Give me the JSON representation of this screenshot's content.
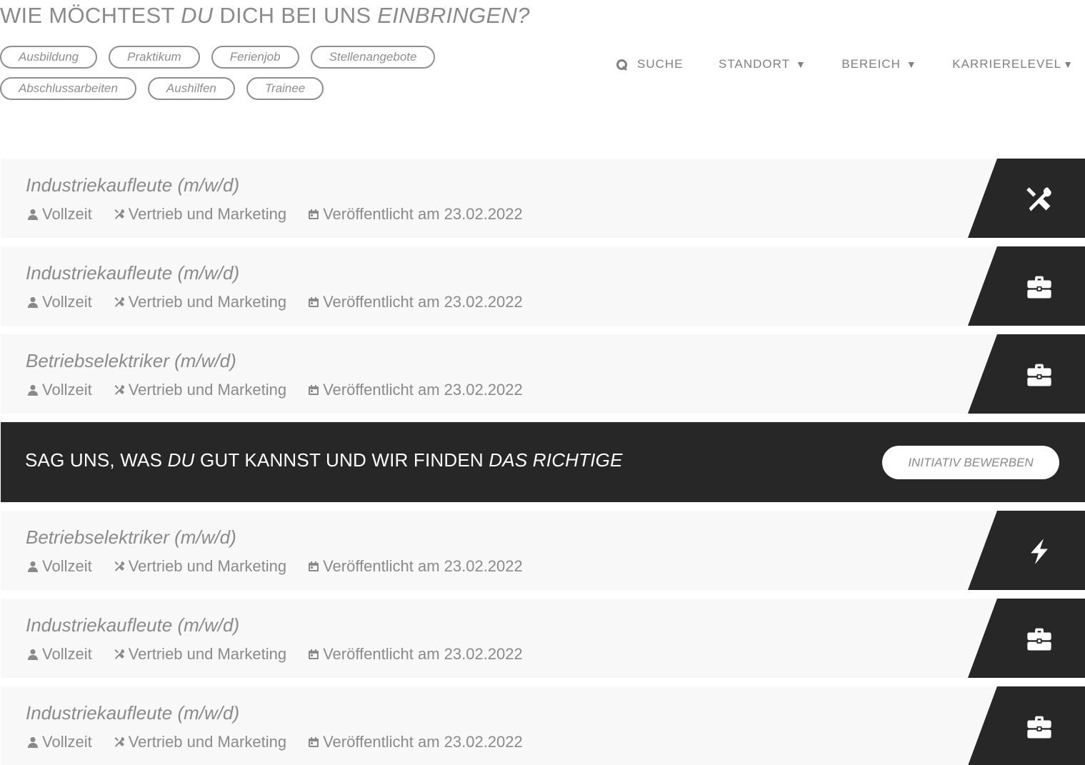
{
  "headline": {
    "part1": "WIE MÖCHTEST ",
    "em1": "DU",
    "part2": " DICH BEI UNS ",
    "em2": "EINBRINGEN?"
  },
  "chips": {
    "row1": [
      "Ausbildung",
      "Praktikum",
      "Ferienjob",
      "Stellenangebote"
    ],
    "row2": [
      "Abschlussarbeiten",
      "Aushilfen",
      "Trainee"
    ]
  },
  "filters": {
    "search": "SUCHE",
    "location": "STANDORT",
    "area": "BEREICH",
    "level": "KARRIERELEVEL",
    "caret": "▼"
  },
  "jobs": [
    {
      "title": "Industriekaufleute (m/w/d)",
      "type": "Vollzeit",
      "department": "Vertrieb und Marketing",
      "published": "Veröffentlicht am 23.02.2022",
      "icon": "tools-icon"
    },
    {
      "title": "Industriekaufleute (m/w/d)",
      "type": "Vollzeit",
      "department": "Vertrieb und Marketing",
      "published": "Veröffentlicht am 23.02.2022",
      "icon": "briefcase-icon"
    },
    {
      "title": "Betriebselektriker (m/w/d)",
      "type": "Vollzeit",
      "department": "Vertrieb und Marketing",
      "published": "Veröffentlicht am 23.02.2022",
      "icon": "briefcase-icon"
    },
    {
      "title": "Betriebselektriker (m/w/d)",
      "type": "Vollzeit",
      "department": "Vertrieb und Marketing",
      "published": "Veröffentlicht am 23.02.2022",
      "icon": "bolt-icon"
    },
    {
      "title": "Industriekaufleute (m/w/d)",
      "type": "Vollzeit",
      "department": "Vertrieb und Marketing",
      "published": "Veröffentlicht am 23.02.2022",
      "icon": "briefcase-icon"
    },
    {
      "title": "Industriekaufleute (m/w/d)",
      "type": "Vollzeit",
      "department": "Vertrieb und Marketing",
      "published": "Veröffentlicht am 23.02.2022",
      "icon": "briefcase-icon"
    }
  ],
  "banner": {
    "part1": "SAG UNS, WAS ",
    "em1": "DU",
    "part2": " GUT KANNST UND WIR FINDEN ",
    "em2": "DAS RICHTIGE",
    "button": "INITIATIV BEWERBEN"
  },
  "colors": {
    "dark": "#272727",
    "row_bg": "#f8f8f8",
    "text": "#8a8a8a"
  }
}
